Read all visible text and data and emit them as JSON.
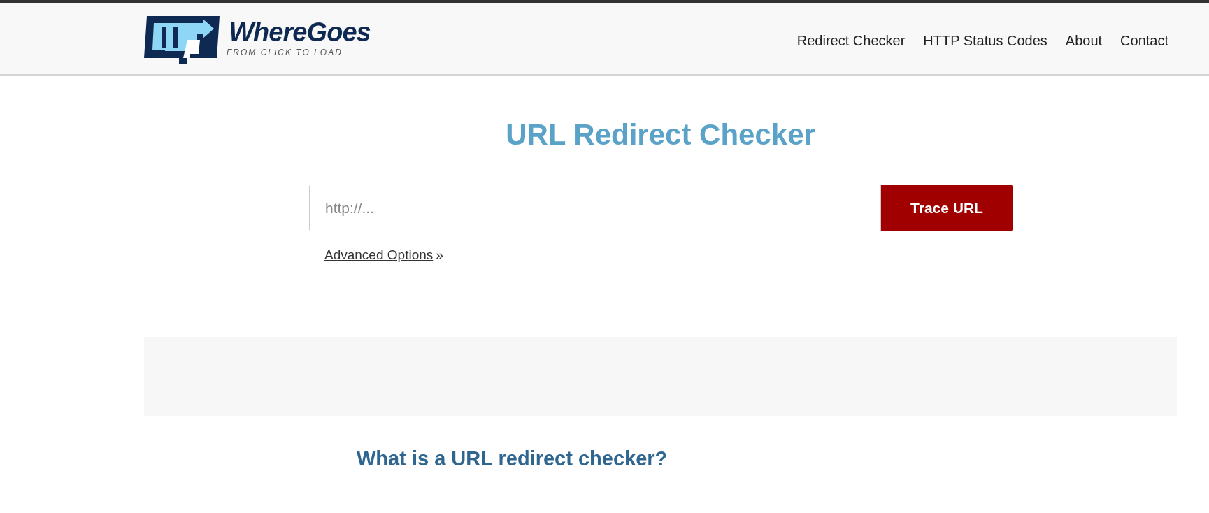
{
  "logo": {
    "name": "WhereGoes",
    "tagline": "FROM CLICK TO LOAD"
  },
  "nav": [
    {
      "label": "Redirect Checker"
    },
    {
      "label": "HTTP Status Codes"
    },
    {
      "label": "About"
    },
    {
      "label": "Contact"
    }
  ],
  "title": "URL Redirect Checker",
  "search": {
    "placeholder": "http://...",
    "button": "Trace URL"
  },
  "advanced": {
    "link": "Advanced Options",
    "suffix": "»"
  },
  "section_heading": "What is a URL redirect checker?"
}
